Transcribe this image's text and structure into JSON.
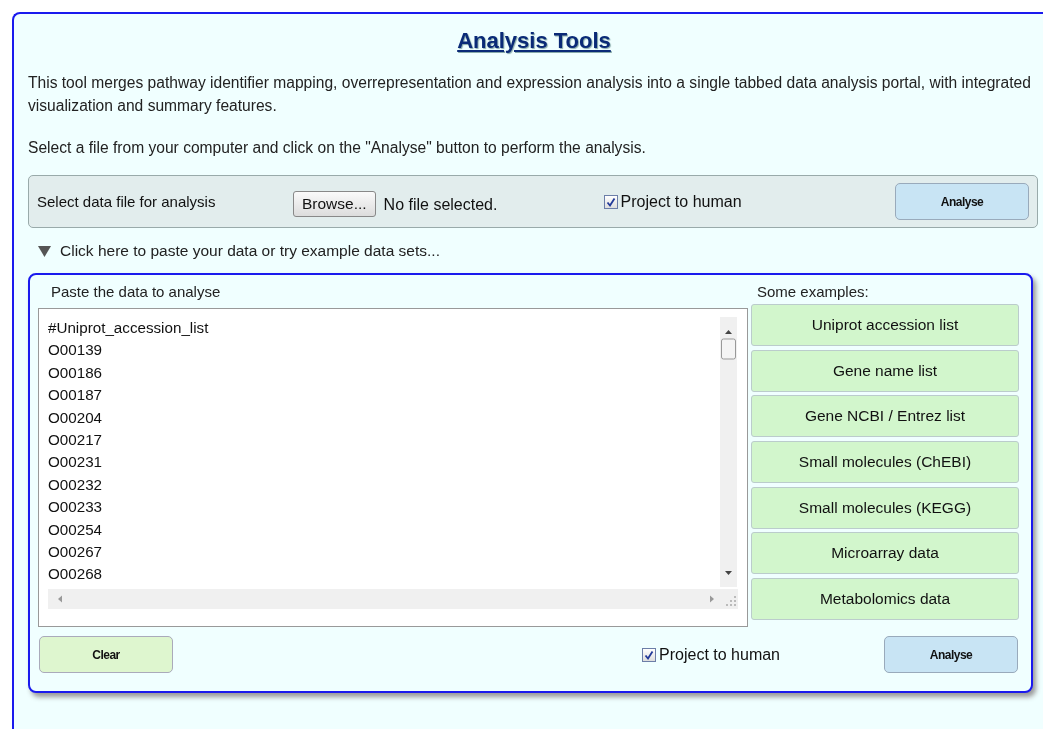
{
  "title": "Analysis Tools",
  "intro": "This tool merges pathway identifier mapping, overrepresentation and expression analysis into a single tabbed data analysis portal, with integrated visualization and summary features.",
  "instruction": "Select a file from your computer and click on the \"Analyse\" button to perform the analysis.",
  "file_bar": {
    "label": "Select data file for analysis",
    "browse_button": "Browse...",
    "file_status": "No file selected.",
    "project_checkbox": {
      "label": "Project to human",
      "checked": true
    },
    "analyse_button": "Analyse"
  },
  "paste_toggle": {
    "label": "Click here to paste your data or try example data sets...",
    "expanded": true
  },
  "paste_panel": {
    "field_label": "Paste the data to analyse",
    "lines": [
      "#Uniprot_accession_list",
      "O00139",
      "O00186",
      "O00187",
      "O00204",
      "O00217",
      "O00231",
      "O00232",
      "O00233",
      "O00254",
      "O00267",
      "O00268"
    ],
    "examples_label": "Some examples:",
    "examples": [
      "Uniprot accession list",
      "Gene name list",
      "Gene NCBI / Entrez list",
      "Small molecules (ChEBI)",
      "Small molecules (KEGG)",
      "Microarray data",
      "Metabolomics data"
    ],
    "clear_button": "Clear",
    "project_checkbox": {
      "label": "Project to human",
      "checked": true
    },
    "analyse_button": "Analyse"
  }
}
